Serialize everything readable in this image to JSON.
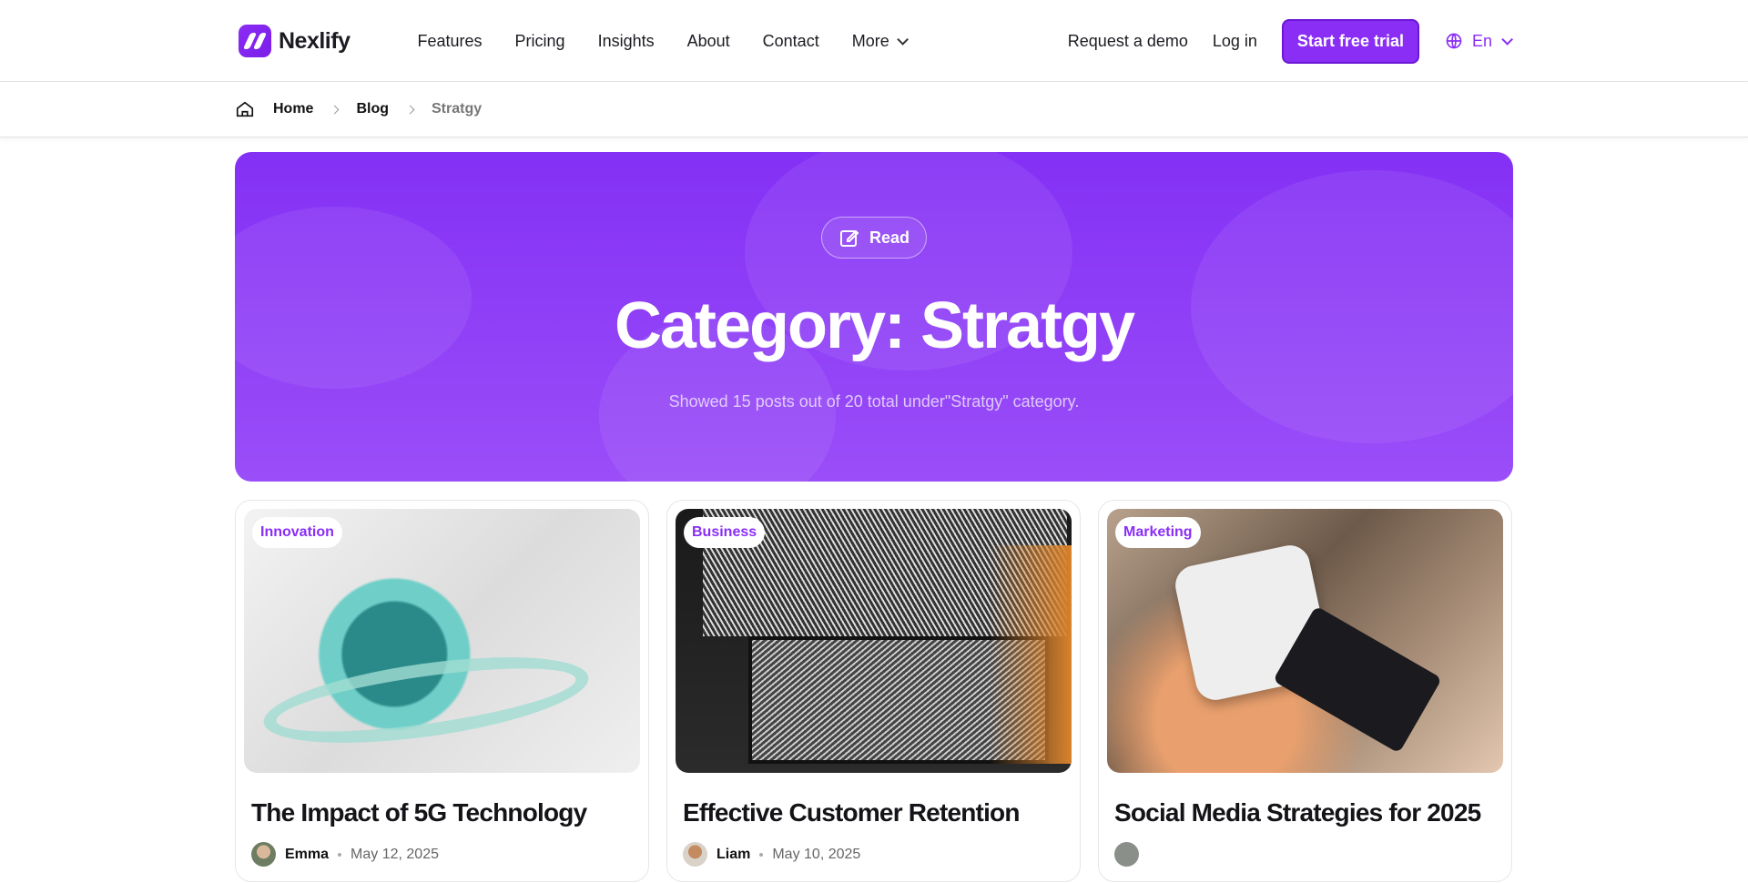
{
  "header": {
    "logo_text": "Nexlify",
    "nav": [
      "Features",
      "Pricing",
      "Insights",
      "About",
      "Contact",
      "More"
    ],
    "request_demo": "Request a demo",
    "login": "Log in",
    "cta": "Start free trial",
    "language": "En"
  },
  "breadcrumb": [
    "Home",
    "Blog",
    "Stratgy"
  ],
  "hero": {
    "badge": "Read",
    "title": "Category: Stratgy",
    "subtitle": "Showed 15 posts out of 20 total under\"Stratgy\" category."
  },
  "posts": [
    {
      "tag": "Innovation",
      "title": "The Impact of 5G Technology",
      "author": "Emma",
      "date": "May 12, 2025"
    },
    {
      "tag": "Business",
      "title": "Effective Customer Retention",
      "author": "Liam",
      "date": "May 10, 2025"
    },
    {
      "tag": "Marketing",
      "title": "Social Media Strategies for 2025",
      "author": "",
      "date": ""
    }
  ],
  "colors": {
    "accent": "#8a2ef6",
    "hero_top": "#8430f5",
    "hero_bottom": "#9a4ef8"
  }
}
